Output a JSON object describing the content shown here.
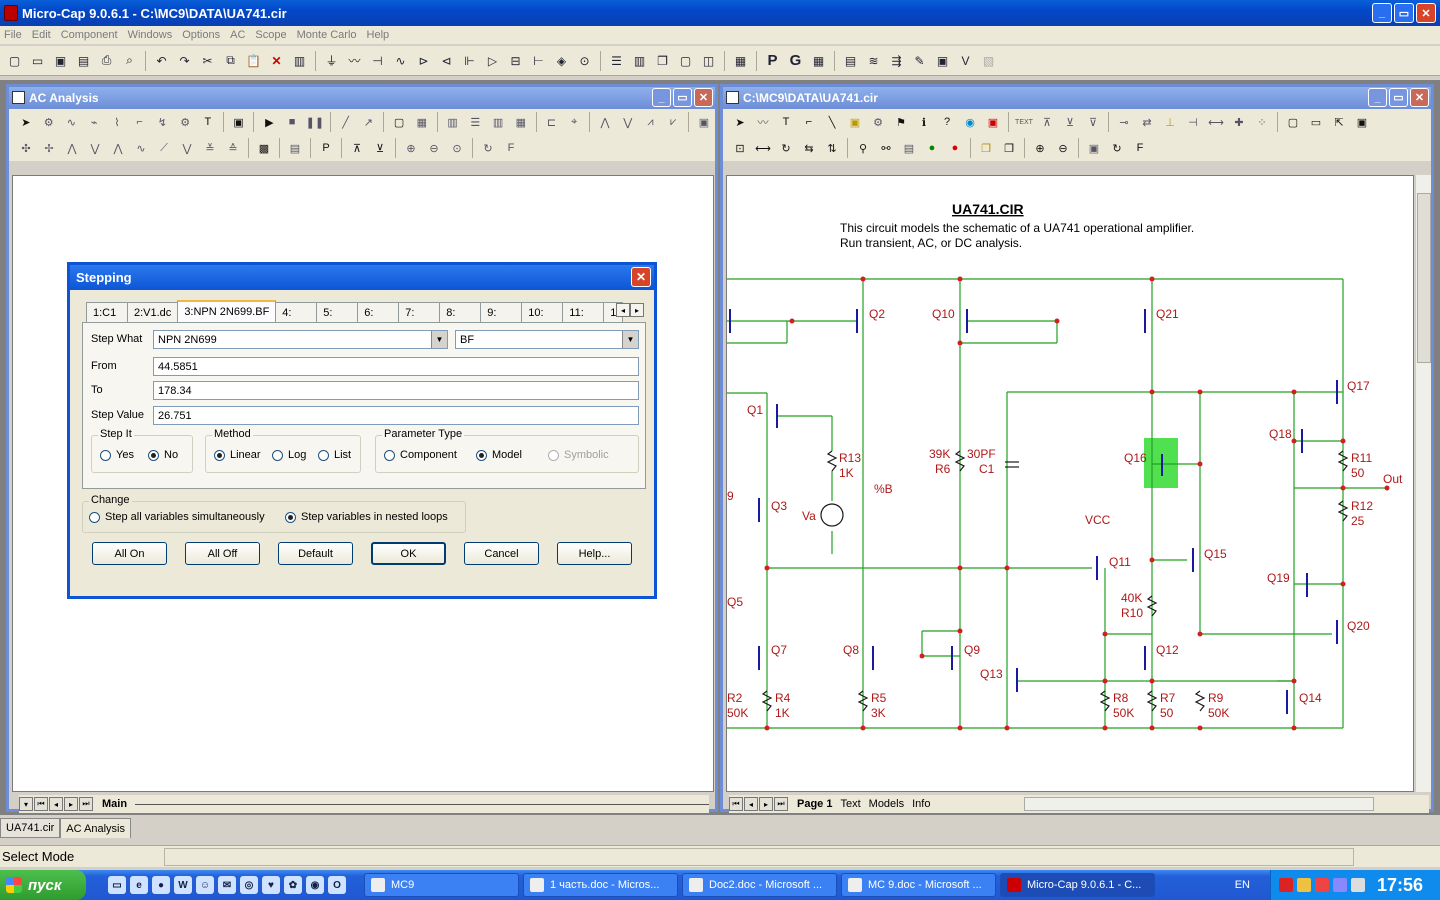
{
  "app": {
    "title": "Micro-Cap 9.0.6.1 - C:\\MC9\\DATA\\UA741.cir",
    "min": "_",
    "max": "▭",
    "close": "✕"
  },
  "menu": [
    "File",
    "Edit",
    "Component",
    "Windows",
    "Options",
    "AC",
    "Scope",
    "Monte Carlo",
    "Help"
  ],
  "toolbar": {
    "icons": [
      "new-file",
      "open",
      "save",
      "save-all",
      "print",
      "print-preview",
      "undo",
      "redo",
      "cut",
      "copy",
      "paste",
      "delete",
      "chip",
      "ground",
      "resistor",
      "capacitor",
      "inductor",
      "diode",
      "npn",
      "pnp",
      "opamp",
      "battery",
      "node",
      "source"
    ],
    "p_label": "P",
    "g_label": "G"
  },
  "ac_window": {
    "title": "AC Analysis",
    "tab": "Main"
  },
  "schematic_window": {
    "title": "C:\\MC9\\DATA\\UA741.cir",
    "tabs": [
      "Page 1",
      "Text",
      "Models",
      "Info"
    ],
    "circuit_title": "UA741.CIR",
    "desc1": "This circuit models the schematic of a UA741 operational amplifier.",
    "desc2": "Run transient, AC, or DC analysis.",
    "labels": {
      "q2": "Q2",
      "q10": "Q10",
      "q21": "Q21",
      "q17": "Q17",
      "q1": "Q1",
      "q18": "Q18",
      "q16": "Q16",
      "r13": "R13",
      "r13v": "1K",
      "pctb": "%B",
      "r6a": "39K",
      "r6": "R6",
      "c1a": "30PF",
      "c1": "C1",
      "r11": "R11",
      "r11v": "50",
      "out": "Out",
      "q3": "Q3",
      "va": "Va",
      "vcc": "VCC",
      "r12": "R12",
      "r12v": "25",
      "q11": "Q11",
      "q15": "Q15",
      "q19": "Q19",
      "q5": "Q5",
      "r10a": "40K",
      "r10": "R10",
      "q20": "Q20",
      "q7": "Q7",
      "q8": "Q8",
      "q9": "Q9",
      "q12": "Q12",
      "q13": "Q13",
      "q14": "Q14",
      "r2": "R2",
      "r2v": "50K",
      "r4": "R4",
      "r4v": "1K",
      "r5": "R5",
      "r5v": "3K",
      "r8": "R8",
      "r8v": "50K",
      "r7": "R7",
      "r7v": "50",
      "r9": "R9",
      "r9v": "50K",
      "nine": "9"
    }
  },
  "stepping": {
    "title": "Stepping",
    "tabs": [
      "1:C1",
      "2:V1.dc",
      "3:NPN 2N699.BF",
      "4:",
      "5:",
      "6:",
      "7:",
      "8:",
      "9:",
      "10:",
      "11:",
      "1"
    ],
    "step_what_label": "Step What",
    "step_what_value": "NPN 2N699",
    "param_value": "BF",
    "from_label": "From",
    "from_value": "44.5851",
    "to_label": "To",
    "to_value": "178.34",
    "step_value_label": "Step Value",
    "step_value_value": "26.751",
    "step_it": {
      "title": "Step It",
      "yes": "Yes",
      "no": "No"
    },
    "method": {
      "title": "Method",
      "linear": "Linear",
      "log": "Log",
      "list": "List"
    },
    "param_type": {
      "title": "Parameter Type",
      "component": "Component",
      "model": "Model",
      "symbolic": "Symbolic"
    },
    "change": {
      "title": "Change",
      "simul": "Step all variables simultaneously",
      "nested": "Step variables in nested loops"
    },
    "buttons": {
      "all_on": "All On",
      "all_off": "All Off",
      "default": "Default",
      "ok": "OK",
      "cancel": "Cancel",
      "help": "Help..."
    }
  },
  "doc_tabs": [
    "UA741.cir",
    "AC Analysis"
  ],
  "status": "Select Mode",
  "taskbar": {
    "start": "пуск",
    "tasks": [
      "MC9",
      "1 часть.doc - Micros...",
      "Doc2.doc - Microsoft ...",
      "MC 9.doc - Microsoft ...",
      "Micro-Cap 9.0.6.1 - C..."
    ],
    "lang": "EN",
    "clock": "17:56"
  }
}
